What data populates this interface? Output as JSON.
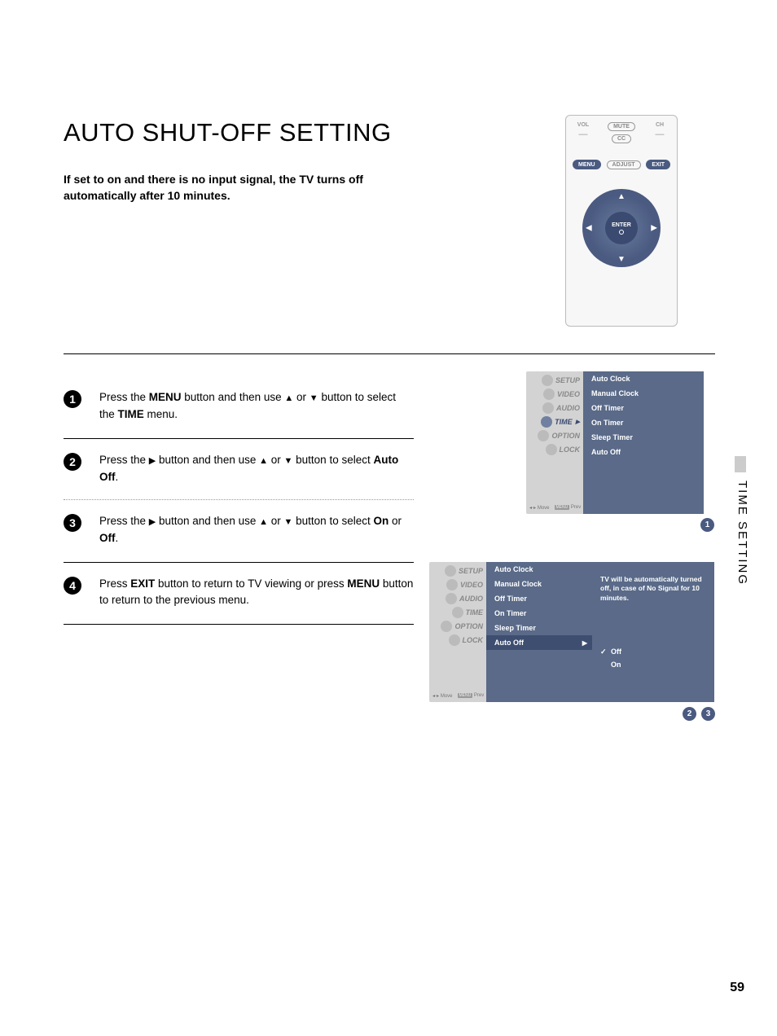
{
  "title": "AUTO SHUT-OFF SETTING",
  "intro": "If set to on and there is no input signal, the TV turns off automatically after 10 minutes.",
  "side_tab": "TIME SETTING",
  "page_number": "59",
  "remote": {
    "vol": "VOL",
    "mute": "MUTE",
    "cc": "CC",
    "ch": "CH",
    "menu": "MENU",
    "adjust": "ADJUST",
    "exit": "EXIT",
    "enter": "ENTER"
  },
  "steps": {
    "s1": {
      "num": "1",
      "pre": "Press the ",
      "btn1": "MENU",
      "mid1": " button and then use ",
      "mid2": " or ",
      "mid3": " button to select the ",
      "btn2": "TIME",
      "post": " menu."
    },
    "s2": {
      "num": "2",
      "pre": "Press the ",
      "mid1": " button and then use ",
      "mid2": " or ",
      "mid3": " button to select ",
      "btn1": "Auto Off",
      "post": "."
    },
    "s3": {
      "num": "3",
      "pre": "Press the ",
      "mid1": " button and then use ",
      "mid2": " or ",
      "mid3": " button to select ",
      "btn1": "On",
      "or": " or ",
      "btn2": "Off",
      "post": "."
    },
    "s4": {
      "num": "4",
      "pre": "Press ",
      "btn1": "EXIT",
      "mid1": " button to return to TV viewing or press ",
      "btn2": "MENU",
      "post": " button to return to the previous menu."
    }
  },
  "glyphs": {
    "up": "▲",
    "down": "▼",
    "right": "▶",
    "left": "◀"
  },
  "osd_left_items": [
    "SETUP",
    "VIDEO",
    "AUDIO",
    "TIME",
    "OPTION",
    "LOCK"
  ],
  "osd_footer": {
    "move": "Move",
    "prev_tag": "MENU",
    "prev": "Prev"
  },
  "osd1_mid": [
    "Auto Clock",
    "Manual Clock",
    "Off Timer",
    "On Timer",
    "Sleep Timer",
    "Auto Off"
  ],
  "osd2_mid": [
    "Auto Clock",
    "Manual Clock",
    "Off Timer",
    "On Timer",
    "Sleep Timer",
    "Auto Off"
  ],
  "osd2_note": "TV will be automatically turned off, in case of No Signal for 10 minutes.",
  "osd2_opts": {
    "off": "Off",
    "on": "On"
  },
  "badges": {
    "b1": "1",
    "b2": "2",
    "b3": "3"
  }
}
